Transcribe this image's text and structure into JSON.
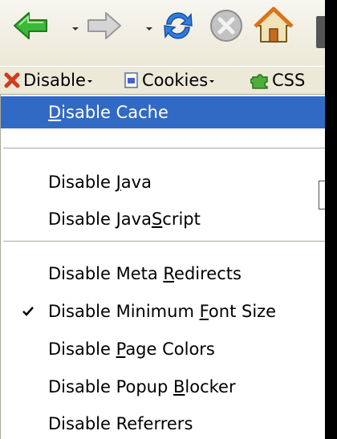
{
  "nav": {
    "buttons": [
      {
        "name": "back-button",
        "icon": "back-arrow-icon",
        "color": "#2ea52b"
      },
      {
        "name": "forward-button",
        "icon": "forward-arrow-icon",
        "color": "#b9b9b9"
      },
      {
        "name": "reload-button",
        "icon": "reload-icon",
        "color": "#2c73d6"
      },
      {
        "name": "stop-button",
        "icon": "stop-icon",
        "color": "#a8a8a8"
      },
      {
        "name": "home-button",
        "icon": "home-icon",
        "color": "#e08a1e"
      }
    ]
  },
  "toolbar": {
    "disable_label": "Disable",
    "cookies_label": "Cookies",
    "css_label": "CSS"
  },
  "menu": {
    "items": [
      {
        "pre": "",
        "key": "D",
        "post": "isable Cache",
        "selected": true,
        "checked": false
      },
      {
        "pre": "Disable ",
        "key": "J",
        "post": "ava",
        "selected": false,
        "checked": false
      },
      {
        "pre": "Disable Java",
        "key": "S",
        "post": "cript",
        "selected": false,
        "checked": false
      },
      {
        "pre": "Disable Meta ",
        "key": "R",
        "post": "edirects",
        "selected": false,
        "checked": false
      },
      {
        "pre": "Disable Minimum ",
        "key": "F",
        "post": "ont Size",
        "selected": false,
        "checked": true
      },
      {
        "pre": "Disable ",
        "key": "P",
        "post": "age Colors",
        "selected": false,
        "checked": false
      },
      {
        "pre": "Disable Popup ",
        "key": "B",
        "post": "locker",
        "selected": false,
        "checked": false
      },
      {
        "pre": "Disable Referrers",
        "key": "",
        "post": "",
        "selected": false,
        "checked": false
      }
    ]
  },
  "colors": {
    "selection": "#316ac5",
    "menu_bg": "#ffffff",
    "toolbar_bg": "#ece9d8"
  }
}
